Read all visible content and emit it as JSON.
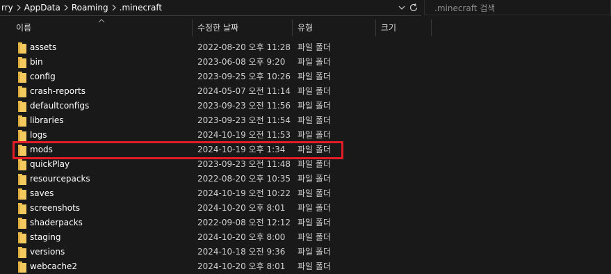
{
  "address": {
    "crumbs": [
      "rry",
      "AppData",
      "Roaming",
      ".minecraft"
    ]
  },
  "search": {
    "placeholder": ".minecraft 검색"
  },
  "columns": {
    "name": "이름",
    "date": "수정한 날짜",
    "type": "유형",
    "size": "크기"
  },
  "files": [
    {
      "name": "assets",
      "date": "2022-08-20 오후 11:28",
      "type": "파일 폴더"
    },
    {
      "name": "bin",
      "date": "2023-06-08 오후 9:20",
      "type": "파일 폴더"
    },
    {
      "name": "config",
      "date": "2023-09-25 오후 10:26",
      "type": "파일 폴더"
    },
    {
      "name": "crash-reports",
      "date": "2024-05-07 오전 11:14",
      "type": "파일 폴더"
    },
    {
      "name": "defaultconfigs",
      "date": "2023-09-23 오전 11:56",
      "type": "파일 폴더"
    },
    {
      "name": "libraries",
      "date": "2023-09-23 오전 11:54",
      "type": "파일 폴더"
    },
    {
      "name": "logs",
      "date": "2024-10-19 오전 11:53",
      "type": "파일 폴더"
    },
    {
      "name": "mods",
      "date": "2024-10-19 오후 1:34",
      "type": "파일 폴더"
    },
    {
      "name": "quickPlay",
      "date": "2023-09-23 오전 11:48",
      "type": "파일 폴더"
    },
    {
      "name": "resourcepacks",
      "date": "2022-08-20 오후 10:35",
      "type": "파일 폴더"
    },
    {
      "name": "saves",
      "date": "2024-10-19 오전 10:22",
      "type": "파일 폴더"
    },
    {
      "name": "screenshots",
      "date": "2024-10-20 오후 8:01",
      "type": "파일 폴더"
    },
    {
      "name": "shaderpacks",
      "date": "2022-09-08 오전 12:12",
      "type": "파일 폴더"
    },
    {
      "name": "staging",
      "date": "2024-10-20 오후 8:00",
      "type": "파일 폴더"
    },
    {
      "name": "versions",
      "date": "2024-10-18 오전 9:36",
      "type": "파일 폴더"
    },
    {
      "name": "webcache2",
      "date": "2024-10-20 오후 8:01",
      "type": "파일 폴더"
    }
  ],
  "highlighted_item": "mods",
  "colors": {
    "background": "#191919",
    "folder_icon": "#f4c95d",
    "highlight": "#e41c25"
  }
}
